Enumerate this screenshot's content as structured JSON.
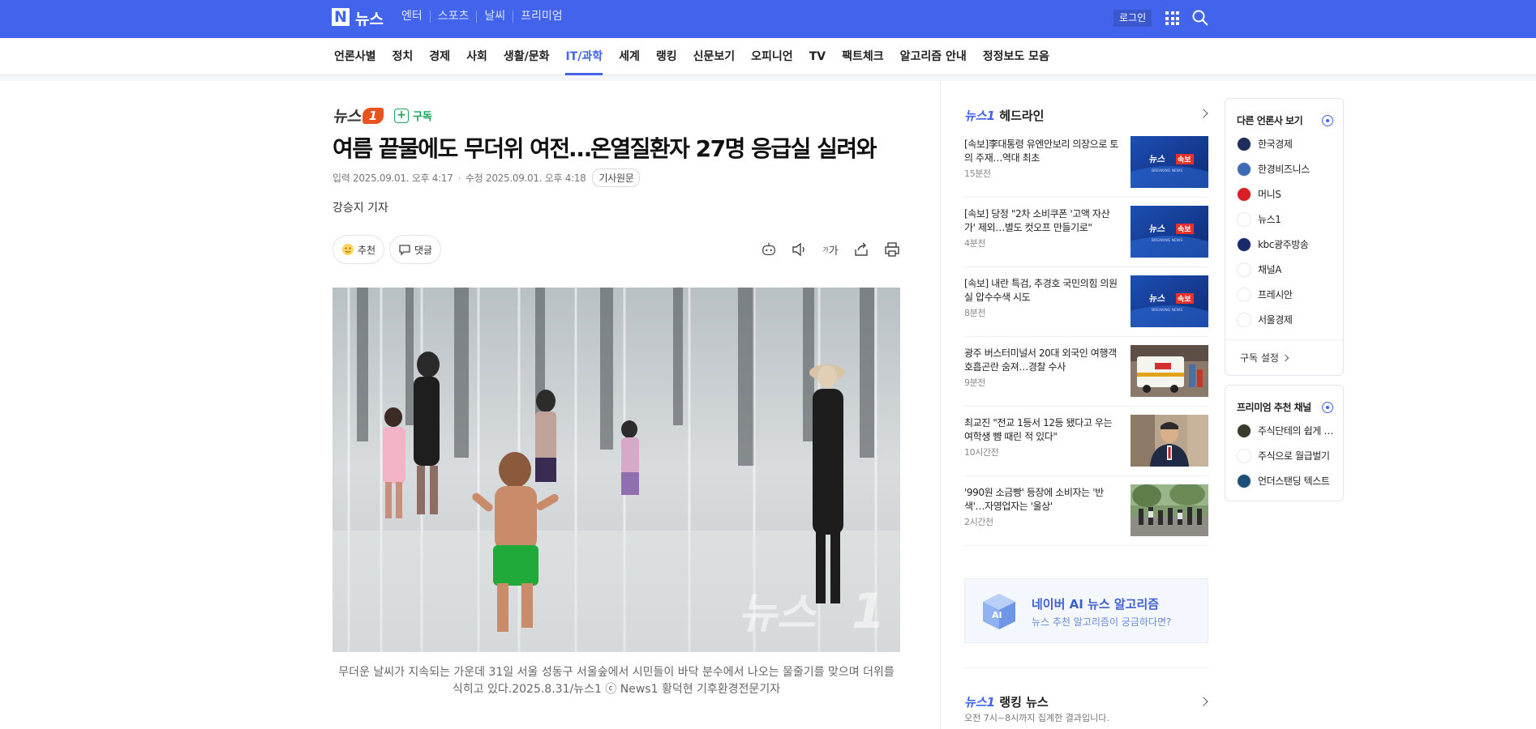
{
  "topbar": {
    "logo_letter": "N",
    "site_name": "뉴스",
    "nav": [
      "엔터",
      "스포츠",
      "날씨",
      "프리미엄"
    ],
    "login": "로그인",
    "bg_color": "#4263eb"
  },
  "categories": {
    "items": [
      "언론사별",
      "정치",
      "경제",
      "사회",
      "생활/문화",
      "IT/과학",
      "세계",
      "랭킹",
      "신문보기",
      "오피니언",
      "TV",
      "팩트체크",
      "알고리즘 안내",
      "정정보도 모음"
    ],
    "active": "IT/과학"
  },
  "article": {
    "press_name": "뉴스",
    "press_mark": "1",
    "subscribe": "구독",
    "title": "여름 끝물에도 무더위 여전…온열질환자 27명 응급실 실려와",
    "input_label": "입력",
    "input_time": "2025.09.01. 오후 4:17",
    "modified_label": "수정",
    "modified_time": "2025.09.01. 오후 4:18",
    "original_link": "기사원문",
    "reporter": "강승지 기자",
    "recommend": "추천",
    "comment": "댓글",
    "font_tool": "가",
    "photo_watermark": "뉴스",
    "caption": "무더운 날씨가 지속되는 가운데 31일 서울 성동구 서울숲에서 시민들이 바닥 분수에서 나오는 물줄기를 맞으며 더위를 식히고 있다.2025.8.31/뉴스1 ⓒ News1 황덕현 기후환경전문기자"
  },
  "headline": {
    "brand": "뉴스1",
    "title": "헤드라인",
    "items": [
      {
        "text": "[속보]李대통령 유엔안보리 의장으로 토의 주재…역대 최초",
        "time": "15분전",
        "thumb": "breaking"
      },
      {
        "text": "[속보] 당정 \"2차 소비쿠폰 '고액 자산가' 제외…별도 컷오프 만들기로\"",
        "time": "4분전",
        "thumb": "breaking"
      },
      {
        "text": "[속보] 내란 특검, 추경호 국민의힘 의원실 압수수색 시도",
        "time": "8분전",
        "thumb": "breaking"
      },
      {
        "text": "광주 버스터미널서 20대 외국인 여행객 호흡곤란 숨져…경찰 수사",
        "time": "9분전",
        "thumb": "ambulance"
      },
      {
        "text": "최교진 \"전교 1등서 12등 됐다고 우는 여학생 뺨 때린 적 있다\"",
        "time": "10시간전",
        "thumb": "person"
      },
      {
        "text": "'990원 소금빵' 등장에 소비자는 '반색'…자영업자는 '울상'",
        "time": "2시간전",
        "thumb": "crowd"
      }
    ],
    "breaking_brand": "뉴스",
    "breaking_badge": "속보",
    "breaking_sub": "BREAKING NEWS"
  },
  "ai_box": {
    "icon_text": "AI",
    "title": "네이버 AI 뉴스 알고리즘",
    "subtitle": "뉴스 추천 알고리즘이 궁금하다면?"
  },
  "ranking": {
    "brand": "뉴스1",
    "title": "랭킹 뉴스",
    "subtitle": "오전 7시~8시까지 집계한 결과입니다."
  },
  "other_press": {
    "title": "다른 언론사 보기",
    "items": [
      {
        "name": "한국경제",
        "color": "#1f2d5c"
      },
      {
        "name": "한경비즈니스",
        "color": "#3c6ab5"
      },
      {
        "name": "머니S",
        "color": "#d91f26"
      },
      {
        "name": "뉴스1",
        "color": "#ffffff"
      },
      {
        "name": "kbc광주방송",
        "color": "#1b2a6b"
      },
      {
        "name": "채널A",
        "color": "#ffffff"
      },
      {
        "name": "프레시안",
        "color": "#ffffff"
      },
      {
        "name": "서울경제",
        "color": "#ffffff"
      }
    ],
    "footer": "구독 설정"
  },
  "premium": {
    "title": "프리미엄 추천 채널",
    "items": [
      {
        "name": "주식단테의 쉽게 배우는",
        "color": "#3b3b2c"
      },
      {
        "name": "주식으로 월급벌기",
        "color": "#ffffff"
      },
      {
        "name": "언더스탠딩 텍스트",
        "color": "#1d4f7a"
      }
    ]
  }
}
